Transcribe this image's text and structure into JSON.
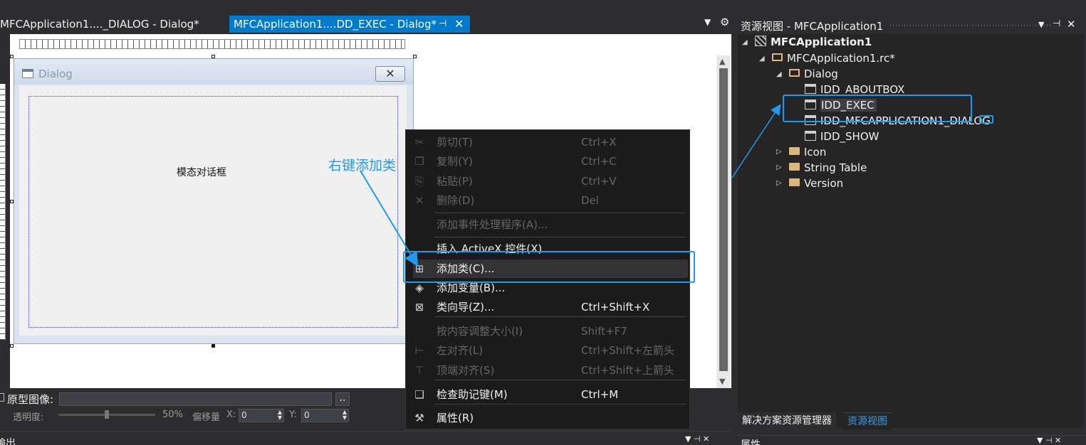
{
  "tabs": [
    {
      "label": "MFCApplication1...._DIALOG - Dialog*",
      "active": false
    },
    {
      "label": "MFCApplication1....DD_EXEC - Dialog*",
      "active": true
    }
  ],
  "dialog": {
    "title": "Dialog",
    "static_text": "模态对话框"
  },
  "annotation": {
    "text": "右键添加类"
  },
  "bottom_controls": {
    "prototype_label": "原型图像:",
    "browse_btn": "..",
    "opacity_label": "透明度:",
    "opacity_value": "50%",
    "offset_label": "偏移量",
    "x_label": "X:",
    "x_value": "0",
    "y_label": "Y:",
    "y_value": "0"
  },
  "context_menu": {
    "items": [
      {
        "label": "剪切(T)",
        "shortcut": "Ctrl+X",
        "disabled": true,
        "icon": "scissors-icon"
      },
      {
        "label": "复制(Y)",
        "shortcut": "Ctrl+C",
        "disabled": true,
        "icon": "copy-icon"
      },
      {
        "label": "粘贴(P)",
        "shortcut": "Ctrl+V",
        "disabled": true,
        "icon": "paste-icon"
      },
      {
        "label": "删除(D)",
        "shortcut": "Del",
        "disabled": true,
        "icon": "delete-icon"
      },
      {
        "label": "添加事件处理程序(A)...",
        "shortcut": "",
        "disabled": true,
        "icon": ""
      },
      {
        "label": "插入 ActiveX 控件(X)...",
        "shortcut": "",
        "disabled": false,
        "icon": ""
      },
      {
        "label": "添加类(C)...",
        "shortcut": "",
        "disabled": false,
        "icon": "add-class-icon",
        "highlighted": true
      },
      {
        "label": "添加变量(B)...",
        "shortcut": "",
        "disabled": false,
        "icon": "add-variable-icon"
      },
      {
        "label": "类向导(Z)...",
        "shortcut": "Ctrl+Shift+X",
        "disabled": false,
        "icon": "class-wizard-icon"
      },
      {
        "label": "按内容调整大小(I)",
        "shortcut": "Shift+F7",
        "disabled": true,
        "icon": ""
      },
      {
        "label": "左对齐(L)",
        "shortcut": "Ctrl+Shift+左箭头",
        "disabled": true,
        "icon": "align-left-icon"
      },
      {
        "label": "顶端对齐(S)",
        "shortcut": "Ctrl+Shift+上箭头",
        "disabled": true,
        "icon": "align-top-icon"
      },
      {
        "label": "检查助记键(M)",
        "shortcut": "Ctrl+M",
        "disabled": false,
        "icon": "mnemonic-icon"
      },
      {
        "label": "属性(R)",
        "shortcut": "",
        "disabled": false,
        "icon": "wrench-icon"
      }
    ]
  },
  "resource_view": {
    "title": "资源视图 - MFCApplication1",
    "tree": {
      "root": "MFCApplication1",
      "rc": "MFCApplication1.rc*",
      "dialog_folder": "Dialog",
      "dialogs": [
        "IDD_ABOUTBOX",
        "IDD_EXEC",
        "IDD_MFCAPPLICATION1_DIALOG",
        "IDD_SHOW"
      ],
      "folders": [
        "Icon",
        "String Table",
        "Version"
      ]
    },
    "bottom_tabs": [
      "解决方案资源管理器",
      "资源视图"
    ]
  },
  "bottom_panels": {
    "left_title": "输出",
    "right_title": "属性"
  },
  "colors": {
    "accent": "#007acc",
    "annotation": "#1e9bf0",
    "menu_bg": "#1b1b1c"
  }
}
